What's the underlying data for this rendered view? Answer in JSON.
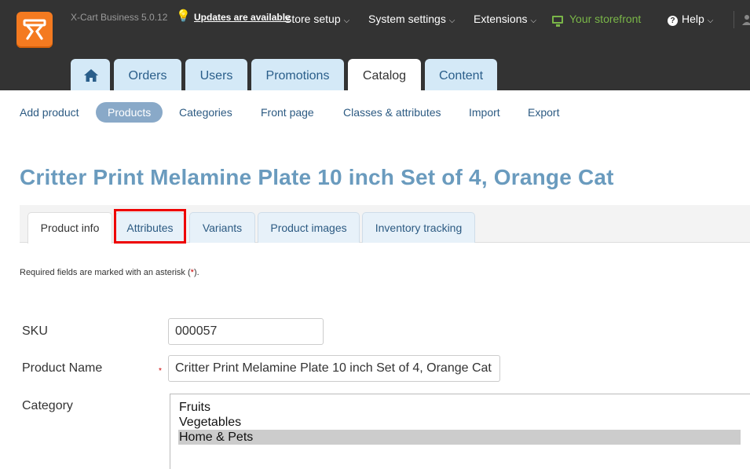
{
  "header": {
    "version": "X-Cart Business 5.0.12",
    "updates_link": "Updates are available",
    "nav": [
      {
        "label": "Store setup"
      },
      {
        "label": "System settings"
      },
      {
        "label": "Extensions"
      },
      {
        "label": "Your storefront"
      },
      {
        "label": "Help"
      }
    ],
    "icons": {
      "updates": "lightbulb-icon",
      "storefront": "monitor-icon",
      "help": "help-icon",
      "user": "user-icon"
    }
  },
  "main_tabs": [
    {
      "label": "",
      "icon": "home-icon"
    },
    {
      "label": "Orders"
    },
    {
      "label": "Users"
    },
    {
      "label": "Promotions"
    },
    {
      "label": "Catalog",
      "active": true
    },
    {
      "label": "Content"
    }
  ],
  "subnav": [
    {
      "label": "Add product"
    },
    {
      "label": "Products",
      "active": true
    },
    {
      "label": "Categories"
    },
    {
      "label": "Front page"
    },
    {
      "label": "Classes & attributes"
    },
    {
      "label": "Import"
    },
    {
      "label": "Export"
    }
  ],
  "page_title": "Critter Print Melamine Plate 10 inch Set of 4, Orange Cat",
  "product_tabs": [
    {
      "label": "Product info",
      "active": true
    },
    {
      "label": "Attributes",
      "highlighted": true
    },
    {
      "label": "Variants"
    },
    {
      "label": "Product images"
    },
    {
      "label": "Inventory tracking"
    }
  ],
  "form": {
    "required_note": "Required fields are marked with an asterisk (",
    "required_star": "*",
    "required_end": ").",
    "sku": {
      "label": "SKU",
      "value": "000057"
    },
    "name": {
      "label": "Product Name",
      "required_mark": "*",
      "value": "Critter Print Melamine Plate 10 inch Set of 4, Orange Cat"
    },
    "category": {
      "label": "Category",
      "options": [
        {
          "label": "Fruits"
        },
        {
          "label": "Vegetables"
        },
        {
          "label": "Home & Pets",
          "selected": true
        }
      ]
    }
  },
  "colors": {
    "topbar": "#333333",
    "logo": "#f47a20",
    "tab_inactive": "#d4e9f7",
    "subnav_active": "#89a9c8",
    "title": "#6a9bbe",
    "highlight_border": "#ee0000",
    "storefront": "#7ab648"
  }
}
